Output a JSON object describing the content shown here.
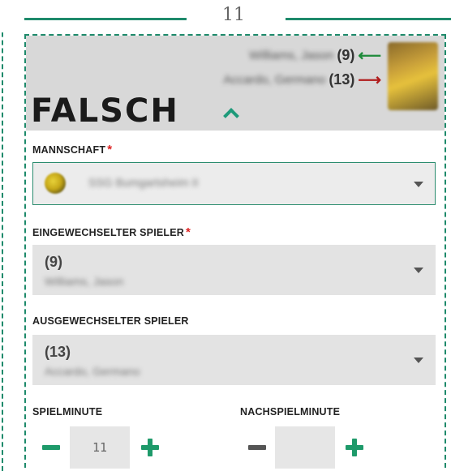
{
  "top": {
    "number": "11"
  },
  "header": {
    "player_in_name": "Williams, Jason",
    "player_in_number": "(9)",
    "player_out_name": "Accardo, Germano",
    "player_out_number": "(13)",
    "status_text": "FALSCH",
    "colors": {
      "in_arrow": "#1e8a3a",
      "out_arrow": "#b01c1c",
      "accent": "#1e8a6b"
    }
  },
  "form": {
    "team": {
      "label": "MANNSCHAFT",
      "required": "*",
      "value": "SSG Bumgartsheim II"
    },
    "sub_in": {
      "label": "EINGEWECHSELTER SPIELER",
      "required": "*",
      "number": "(9)",
      "name": "Williams, Jason"
    },
    "sub_out": {
      "label": "AUSGEWECHSELTER SPIELER",
      "number": "(13)",
      "name": "Accardo, Germano"
    },
    "minute": {
      "label": "SPIELMINUTE",
      "value": "11"
    },
    "extra_minute": {
      "label": "NACHSPIELMINUTE",
      "value": ""
    }
  }
}
